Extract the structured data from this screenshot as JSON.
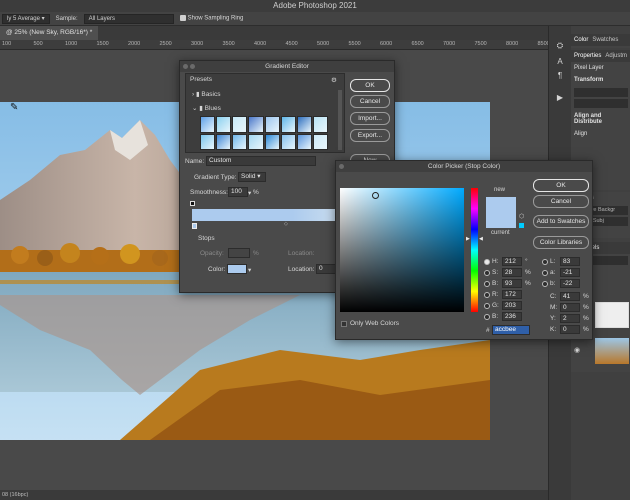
{
  "app": {
    "title": "Adobe Photoshop 2021"
  },
  "options": {
    "sample_size": "ly 5 Average",
    "sample_label": "Sample:",
    "sample_value": "All Layers",
    "ring_label": "Show Sampling Ring"
  },
  "doc": {
    "tab": "@ 25% (New Sky, RGB/16*) *"
  },
  "ruler": {
    "ticks": [
      "100",
      "500",
      "1000",
      "1500",
      "2000",
      "2500",
      "3000",
      "3500",
      "4000",
      "4500",
      "5000",
      "5500",
      "6000",
      "6500",
      "7000",
      "7500",
      "8000",
      "8500",
      "9000"
    ]
  },
  "status": {
    "text": "08 (16bpc)"
  },
  "right": {
    "tabs": [
      "Color",
      "Swatches"
    ],
    "props_tabs": [
      "Properties",
      "Adjustm"
    ],
    "pixel_layer": "Pixel Layer",
    "transform": "Transform",
    "align": "Align and Distribute",
    "align_sub": "Align",
    "actions": "Actions",
    "remove_bg": "Remove Backgr",
    "select_sub": "Select Subj",
    "channels": "Channels"
  },
  "gradient_editor": {
    "title": "Gradient Editor",
    "presets": "Presets",
    "folders": [
      "Basics",
      "Blues"
    ],
    "ok": "OK",
    "cancel": "Cancel",
    "import": "Import...",
    "export": "Export...",
    "new": "New",
    "name_label": "Name:",
    "name_value": "Custom",
    "type_label": "Gradient Type:",
    "type_value": "Solid",
    "smooth_label": "Smoothness:",
    "smooth_value": "100",
    "smooth_unit": "%",
    "stops": "Stops",
    "opacity_label": "Opacity:",
    "pct": "%",
    "location_label": "Location:",
    "color_label": "Color:",
    "location2_label": "Location:",
    "location2_value": "0"
  },
  "color_picker": {
    "title": "Color Picker (Stop Color)",
    "new": "new",
    "current": "current",
    "ok": "OK",
    "cancel": "Cancel",
    "add": "Add to Swatches",
    "libs": "Color Libraries",
    "web_only": "Only Web Colors",
    "fields": [
      {
        "k": "H:",
        "v": "212",
        "u": "°"
      },
      {
        "k": "S:",
        "v": "28",
        "u": "%"
      },
      {
        "k": "B:",
        "v": "93",
        "u": "%"
      },
      {
        "k": "R:",
        "v": "172",
        "u": ""
      },
      {
        "k": "G:",
        "v": "203",
        "u": ""
      },
      {
        "k": "B:",
        "v": "236",
        "u": ""
      }
    ],
    "fields2": [
      {
        "k": "L:",
        "v": "83"
      },
      {
        "k": "a:",
        "v": "-21"
      },
      {
        "k": "b:",
        "v": "-22"
      },
      {
        "k": "C:",
        "v": "41",
        "u": "%"
      },
      {
        "k": "M:",
        "v": "0",
        "u": "%"
      },
      {
        "k": "Y:",
        "v": "2",
        "u": "%"
      },
      {
        "k": "K:",
        "v": "0",
        "u": "%"
      }
    ],
    "hex_label": "#",
    "hex": "accbee"
  },
  "colors": {
    "stop_color": "#accbee",
    "hue_top": "#ff0000"
  }
}
